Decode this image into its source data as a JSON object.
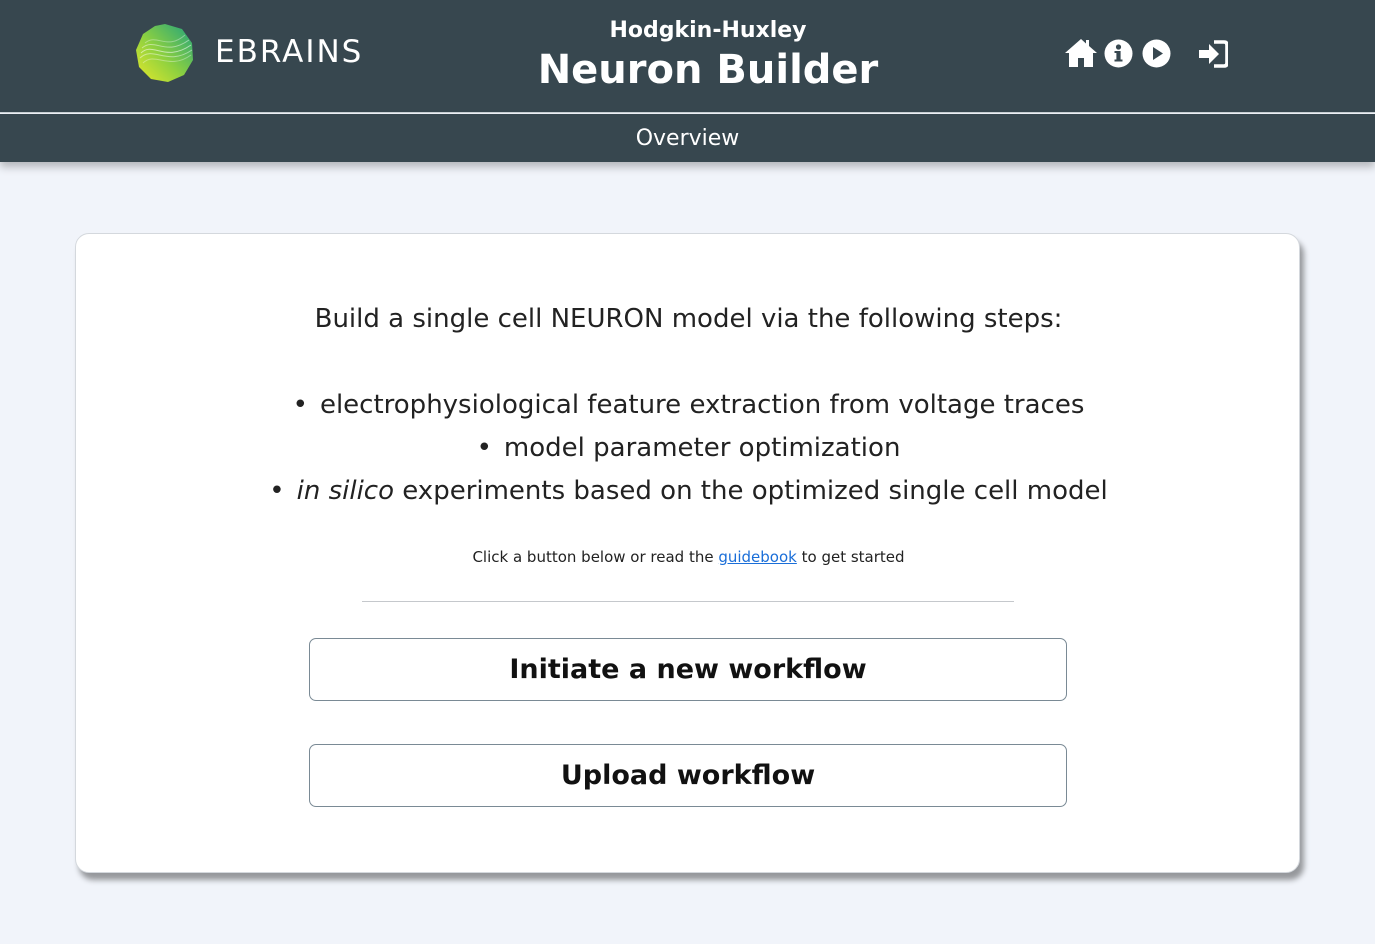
{
  "header": {
    "brand": "EBRAINS",
    "subtitle": "Hodgkin-Huxley",
    "title": "Neuron Builder",
    "icons": [
      "home-icon",
      "info-icon",
      "play-icon",
      "login-icon"
    ],
    "background_color": "#37474f"
  },
  "subnav": {
    "label": "Overview"
  },
  "card": {
    "intro": "Build a single cell NEURON model via the following steps:",
    "steps": [
      "electrophysiological feature extraction from voltage traces",
      "model parameter optimization",
      {
        "emphasis": "in silico",
        "rest": " experiments based on the optimized single cell model"
      }
    ],
    "hint_before": "Click a button below or read the ",
    "hint_link": "guidebook",
    "hint_after": " to get started",
    "buttons": {
      "new_workflow": "Initiate a new workflow",
      "upload_workflow": "Upload workflow"
    }
  },
  "colors": {
    "page_background": "#f1f4fa",
    "link": "#1a6ed8"
  }
}
